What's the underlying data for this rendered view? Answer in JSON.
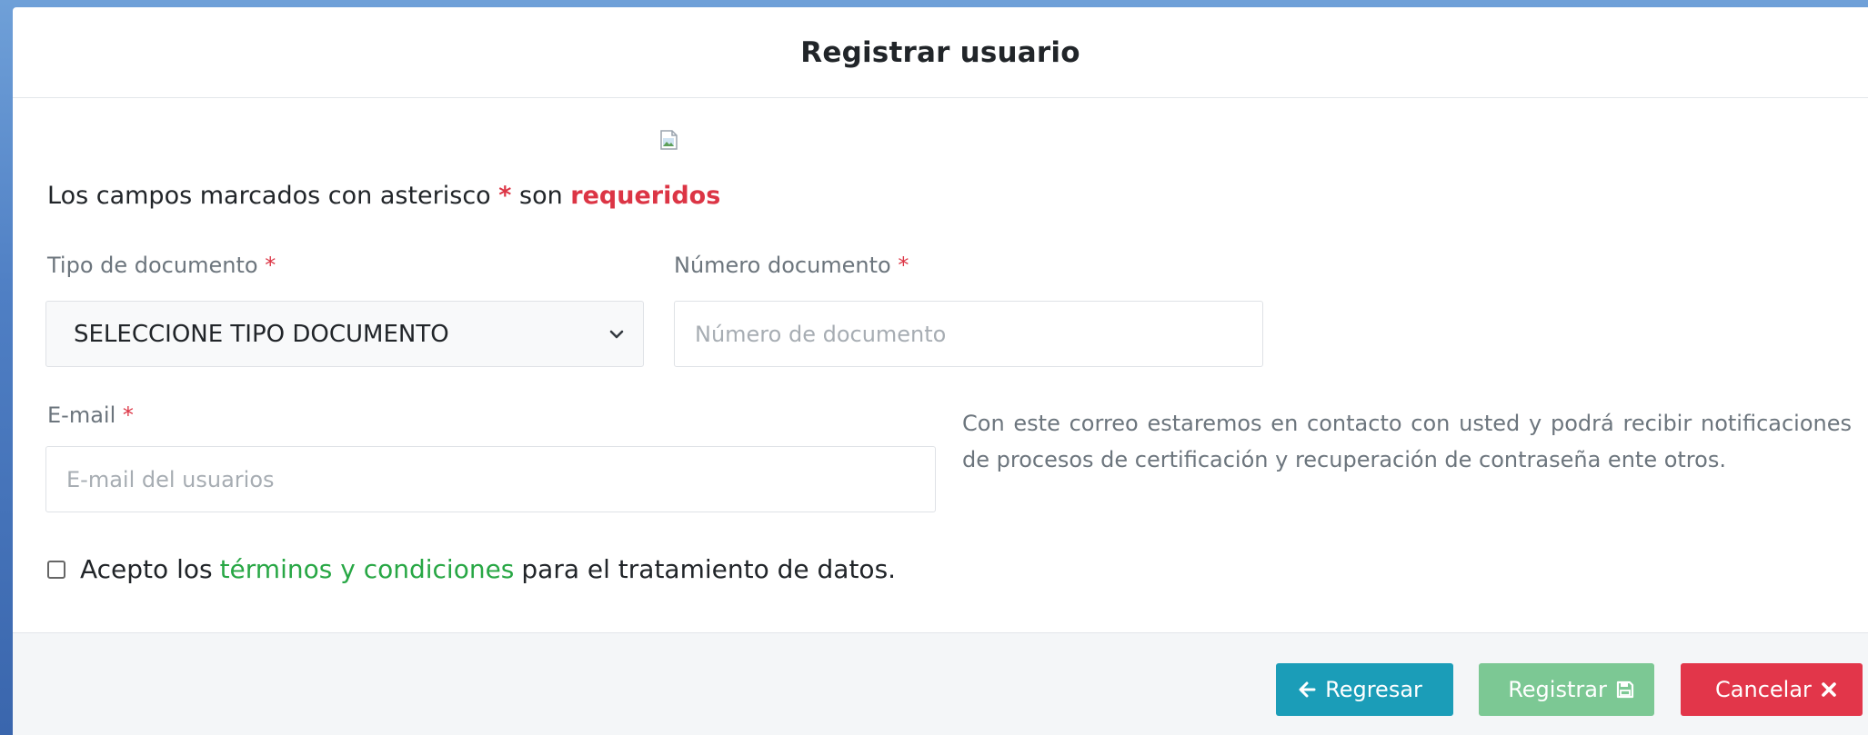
{
  "modal": {
    "title": "Registrar usuario"
  },
  "notice": {
    "prefix": "Los campos marcados con asterisco",
    "asterisk": "*",
    "middle": "son",
    "emphasis": "requeridos"
  },
  "form": {
    "doc_type": {
      "label": "Tipo de documento",
      "required_mark": "*",
      "selected": "SELECCIONE TIPO DOCUMENTO"
    },
    "doc_number": {
      "label": "Número documento",
      "required_mark": "*",
      "placeholder": "Número de documento"
    },
    "email": {
      "label": "E-mail",
      "required_mark": "*",
      "placeholder": "E-mail del usuarios",
      "help": "Con este correo estaremos en contacto con usted y podrá recibir notificaciones de procesos de certificación y recuperación de contraseña ente otros."
    },
    "terms": {
      "checked": false,
      "prefix": "Acepto los",
      "link": "términos y condiciones",
      "suffix": "para el tratamiento de datos."
    }
  },
  "footer": {
    "back": {
      "label": "Regresar",
      "icon": "arrow-left-icon",
      "color": "#1b9db8"
    },
    "register": {
      "label": "Registrar",
      "icon": "save-icon",
      "color": "#7cc894"
    },
    "cancel": {
      "label": "Cancelar",
      "icon": "close-icon",
      "color": "#e2364a"
    }
  },
  "colors": {
    "required": "#dc3545",
    "link": "#28a745"
  }
}
